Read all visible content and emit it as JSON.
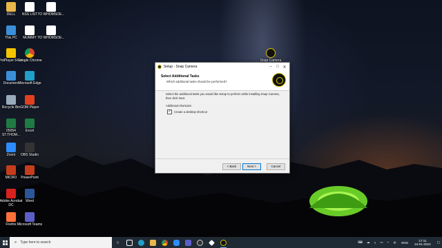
{
  "desktop": {
    "icons": [
      {
        "label": "DELL",
        "icon": "folder-icon",
        "color": "#e8b84a"
      },
      {
        "label": "NSS LIST",
        "icon": "document-icon",
        "color": "#ffffff"
      },
      {
        "label": "TO WHOMSOE...",
        "icon": "document-icon",
        "color": "#ffffff"
      },
      {
        "label": "This PC",
        "icon": "computer-icon",
        "color": "#3a8fd8"
      },
      {
        "label": "MUMMY",
        "icon": "document-icon",
        "color": "#ffffff"
      },
      {
        "label": "TO WHOMSOE...",
        "icon": "document-icon",
        "color": "#ffffff"
      },
      {
        "label": "PotPlayer 64 bit",
        "icon": "potplayer-icon",
        "color": "#f5c400"
      },
      {
        "label": "Google Chrome",
        "icon": "chrome-icon",
        "color": "#4caf50"
      },
      {
        "label": "Document",
        "icon": "folder-icon",
        "color": "#3a8fd8"
      },
      {
        "label": "Microsoft Edge",
        "icon": "edge-icon",
        "color": "#1fa0c8"
      },
      {
        "label": "Recycle Bin",
        "icon": "recycle-bin-icon",
        "color": "#9ab"
      },
      {
        "label": "GOM Player",
        "icon": "gom-player-icon",
        "color": "#e04020"
      },
      {
        "label": "05054 ST.THOM...",
        "icon": "excel-icon",
        "color": "#1f7a44"
      },
      {
        "label": "Excel",
        "icon": "excel-icon",
        "color": "#1f7a44"
      },
      {
        "label": "Zoom",
        "icon": "zoom-icon",
        "color": "#2d8cff"
      },
      {
        "label": "OBS Studio",
        "icon": "obs-icon",
        "color": "#333"
      },
      {
        "label": "MICRO",
        "icon": "powerpoint-icon",
        "color": "#c43e1c"
      },
      {
        "label": "PowerPoint",
        "icon": "powerpoint-icon",
        "color": "#c43e1c"
      },
      {
        "label": "Adobe Acrobat DC",
        "icon": "acrobat-icon",
        "color": "#d8221d"
      },
      {
        "label": "Word",
        "icon": "word-icon",
        "color": "#2b579a"
      },
      {
        "label": "Firefox",
        "icon": "firefox-icon",
        "color": "#ff7139"
      },
      {
        "label": "Microsoft Teams",
        "icon": "teams-icon",
        "color": "#5b5fc7"
      },
      {
        "label": "Snap Camera",
        "icon": "snap-camera-icon",
        "color": "#d8c400"
      }
    ]
  },
  "dialog": {
    "title": "Setup - Snap Camera",
    "heading": "Select Additional Tasks",
    "subheading": "Which additional tasks should be performed?",
    "intro": "Select the additional tasks you would like Setup to perform while installing Snap Camera, then click Next.",
    "section_label": "Additional shortcuts:",
    "checkbox_label": "Create a desktop shortcut",
    "checkbox_checked": "✓",
    "back_label": "< Back",
    "next_label": "Next >",
    "cancel_label": "Cancel",
    "minimize": "–",
    "maximize": "□",
    "close": "✕"
  },
  "taskbar": {
    "search_placeholder": "Type here to search",
    "language": "ENG",
    "time": "17:11",
    "date": "24-01-2022"
  }
}
